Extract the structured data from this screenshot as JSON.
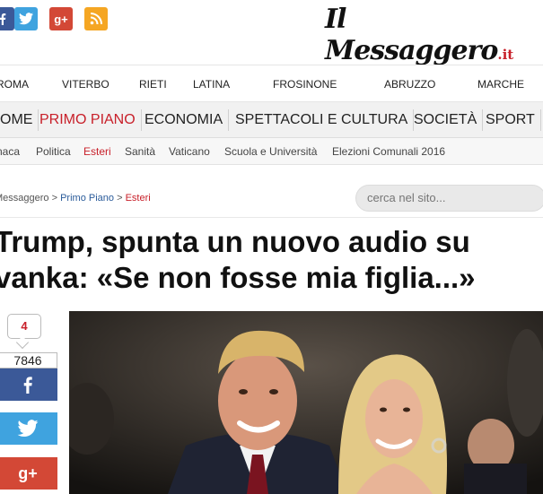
{
  "logo": {
    "name": "Il Messaggero",
    "suffix": ".it"
  },
  "social_top": {
    "facebook": "facebook-icon",
    "twitter": "twitter-icon",
    "googleplus": "google-plus-icon",
    "rss": "rss-icon",
    "googleplus_label": "g+"
  },
  "cities": [
    "ROMA",
    "VITERBO",
    "RIETI",
    "LATINA",
    "FROSINONE",
    "ABRUZZO",
    "MARCHE"
  ],
  "main_nav": [
    {
      "label": "OME",
      "active": false
    },
    {
      "label": "PRIMO PIANO",
      "active": true
    },
    {
      "label": "ECONOMIA",
      "active": false
    },
    {
      "label": "SPETTACOLI E CULTURA",
      "active": false
    },
    {
      "label": "SOCIETÀ",
      "active": false
    },
    {
      "label": "SPORT",
      "active": false
    }
  ],
  "sub_nav": [
    {
      "label": "naca",
      "active": false
    },
    {
      "label": "Politica",
      "active": false
    },
    {
      "label": "Esteri",
      "active": true
    },
    {
      "label": "Sanità",
      "active": false
    },
    {
      "label": "Vaticano",
      "active": false
    },
    {
      "label": "Scuola e Università",
      "active": false
    },
    {
      "label": "Elezioni Comunali 2016",
      "active": false
    }
  ],
  "breadcrumb": {
    "home": "Messaggero",
    "section": "Primo Piano",
    "current": "Esteri",
    "sep": " > "
  },
  "search": {
    "placeholder": "cerca nel sito..."
  },
  "article": {
    "headline_line1": "Trump, spunta un nuovo audio su",
    "headline_line2": "vanka: «Se non fosse mia figlia...»"
  },
  "share": {
    "comments": "4",
    "fb_count": "7846",
    "fb_label": "f",
    "gp_label": "g+"
  },
  "colors": {
    "accent_red": "#c8202a",
    "facebook": "#3b5998",
    "twitter": "#3fa3df",
    "googleplus": "#d34836",
    "rss": "#f5a623"
  }
}
